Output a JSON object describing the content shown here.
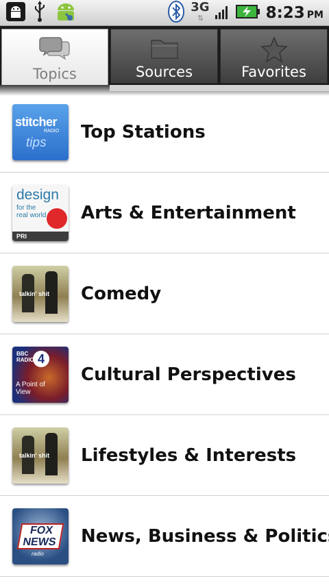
{
  "status_bar": {
    "left_icons": [
      "android-debug-icon",
      "usb-icon",
      "android-robot-icon"
    ],
    "right_icons": [
      "bluetooth-icon",
      "signal-icon",
      "battery-charging-icon"
    ],
    "network": "3G",
    "time": "8:23",
    "ampm": "PM"
  },
  "tabs": [
    {
      "label": "Topics",
      "icon": "chat-bubbles-icon",
      "active": true
    },
    {
      "label": "Sources",
      "icon": "folder-icon",
      "active": false
    },
    {
      "label": "Favorites",
      "icon": "star-icon",
      "active": false
    }
  ],
  "topics": [
    {
      "label": "Top Stations",
      "thumb_texts": [
        "stitcher",
        "RADIO",
        "tips"
      ]
    },
    {
      "label": "Arts & Entertainment",
      "thumb_texts": [
        "design",
        "for the real world",
        "PRI"
      ]
    },
    {
      "label": "Comedy",
      "thumb_texts": [
        "talkin' shit"
      ]
    },
    {
      "label": "Cultural Perspectives",
      "thumb_texts": [
        "BBC RADIO",
        "4",
        "A Point of View"
      ]
    },
    {
      "label": "Lifestyles & Interests",
      "thumb_texts": [
        "talkin' shit"
      ]
    },
    {
      "label": "News, Business & Politics",
      "thumb_texts": [
        "FOX NEWS",
        "radio"
      ]
    }
  ]
}
